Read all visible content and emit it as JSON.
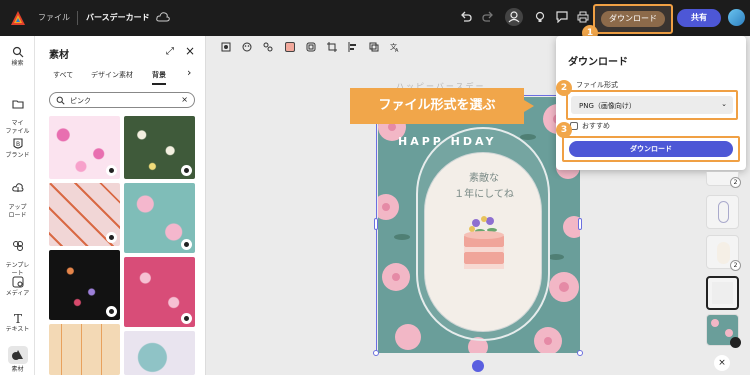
{
  "topbar": {
    "file_menu": "ファイル",
    "doc_title": "バースデーカード",
    "download_label": "ダウンロード",
    "share_label": "共有"
  },
  "rail": {
    "items": [
      {
        "label": "検索",
        "icon": "search-icon"
      },
      {
        "label": "マイ\nファイル",
        "icon": "folder-icon"
      },
      {
        "label": "ブランド",
        "icon": "brand-icon"
      },
      {
        "label": "アップ\nロード",
        "icon": "upload-icon"
      },
      {
        "label": "テンプレ\nート",
        "icon": "template-icon"
      },
      {
        "label": "メディア",
        "icon": "media-icon"
      },
      {
        "label": "テキスト",
        "icon": "text-icon"
      },
      {
        "label": "素材",
        "icon": "assets-icon"
      }
    ]
  },
  "panel": {
    "title": "素材",
    "tabs": [
      "すべて",
      "デザイン素材",
      "背景"
    ],
    "search_value": "ピンク"
  },
  "canvas": {
    "card_message_line1": "素敵な",
    "card_message_line2": "１年にしてね",
    "arc_text": "HAPP      HDAY",
    "faded_title": "ハッピーバースデー"
  },
  "callout": {
    "text": "ファイル形式を選ぶ"
  },
  "popover": {
    "title": "ダウンロード",
    "file_format_label": "ファイル形式",
    "file_format_value": "PNG（画像向け）",
    "recommended_label": "おすすめ",
    "download_button": "ダウンロード"
  },
  "step_badges": [
    "1",
    "2",
    "3"
  ],
  "pages": {
    "badges": [
      "2",
      "2"
    ],
    "close": "×"
  },
  "colors": {
    "accent": "#f1a64a",
    "primary": "#4d57d6",
    "card_bg": "#6a9e9a"
  }
}
